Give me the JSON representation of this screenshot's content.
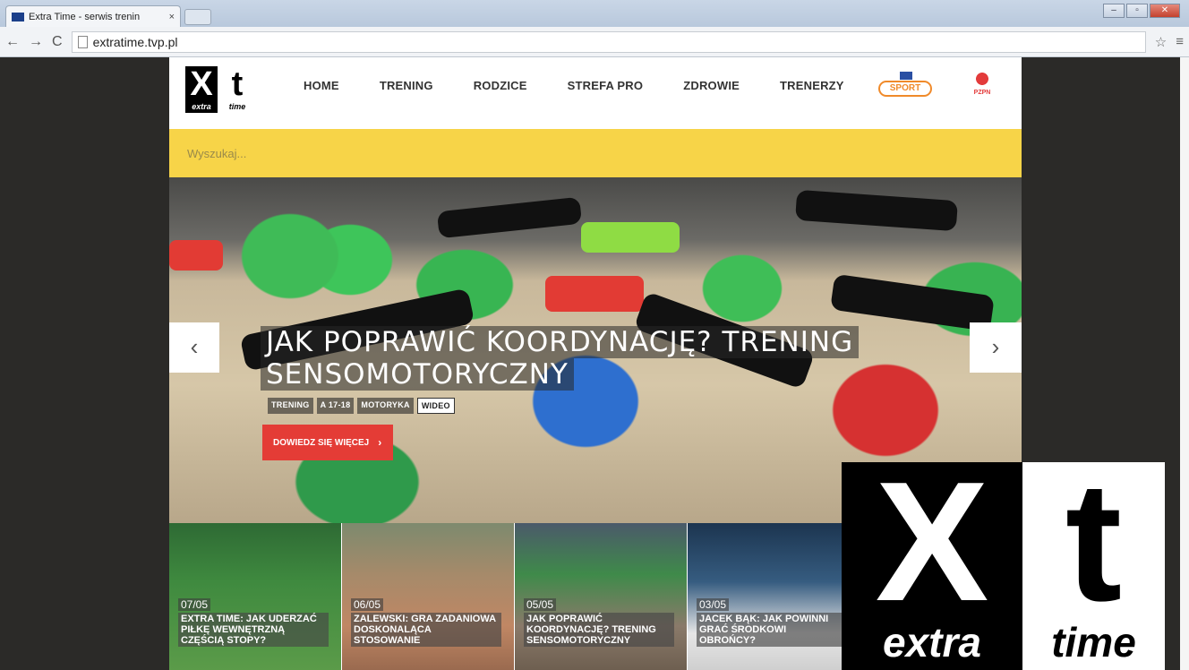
{
  "browser": {
    "tab_title": "Extra Time - serwis trenin",
    "tab_close": "×",
    "url": "extratime.tvp.pl",
    "back_icon": "←",
    "forward_icon": "→",
    "reload_icon": "C",
    "star_icon": "☆",
    "menu_icon": "≡",
    "window_controls": [
      "–",
      "▫",
      "✕"
    ]
  },
  "header": {
    "logo_x": "X",
    "logo_x_word": "extra",
    "logo_t": "t",
    "logo_t_word": "time",
    "nav": [
      "HOME",
      "TRENING",
      "RODZICE",
      "STREFA PRO",
      "ZDROWIE",
      "TRENERZY"
    ],
    "tvp_sport": "SPORT",
    "pzpn": "PZPN"
  },
  "search": {
    "placeholder": "Wyszukaj..."
  },
  "hero": {
    "title": "JAK POPRAWIĆ KOORDYNACJĘ? TRENING SENSOMOTORYCZNY",
    "tags": [
      "TRENING",
      "A 17-18",
      "MOTORYKA",
      "WIDEO"
    ],
    "cta": "DOWIEDZ SIĘ WIĘCEJ",
    "cta_icon": "›",
    "prev": "‹",
    "next": "›"
  },
  "tiles": [
    {
      "date": "07/05",
      "caption": "EXTRA TIME: JAK UDERZAĆ PIŁKĘ WEWNĘTRZNĄ CZĘŚCIĄ STOPY?"
    },
    {
      "date": "06/05",
      "caption": "ZALEWSKI: GRA ZADANIOWA DOSKONALĄCA STOSOWANIE"
    },
    {
      "date": "05/05",
      "caption": "JAK POPRAWIĆ KOORDYNACJĘ? TRENING SENSOMOTORYCZNY"
    },
    {
      "date": "03/05",
      "caption": "JACEK BĄK: JAK POWINNI GRAĆ ŚRODKOWI OBROŃCY?"
    }
  ],
  "overlay_logo": {
    "x": "X",
    "x_word": "extra",
    "t": "t",
    "t_word": "time"
  },
  "colors": {
    "accent_yellow": "#f7d448",
    "cta_red": "#e43c36"
  }
}
